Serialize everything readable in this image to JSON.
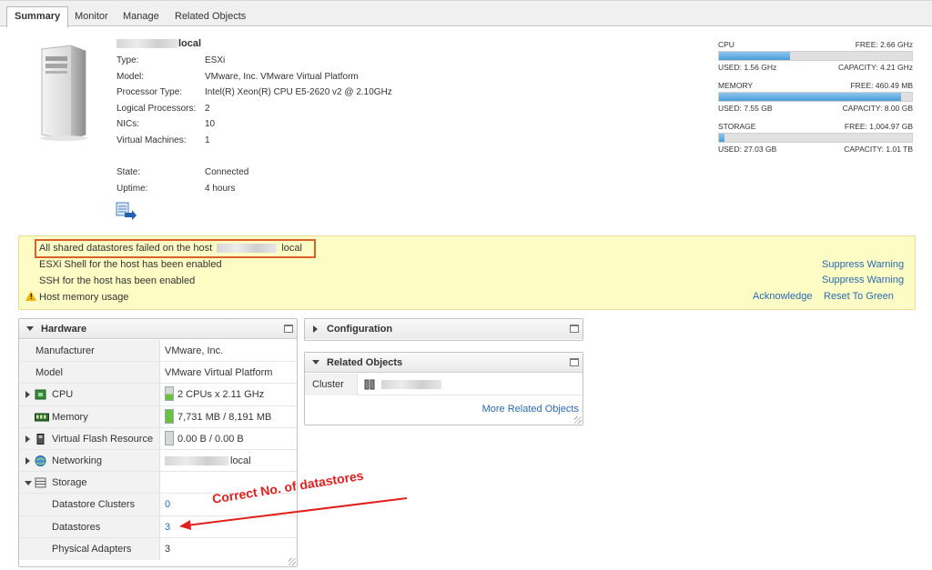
{
  "tabs": [
    {
      "label": "Summary",
      "active": true
    },
    {
      "label": "Monitor",
      "active": false
    },
    {
      "label": "Manage",
      "active": false
    },
    {
      "label": "Related Objects",
      "active": false
    }
  ],
  "host": {
    "name_suffix": "local",
    "fields": [
      {
        "key": "Type:",
        "value": "ESXi"
      },
      {
        "key": "Model:",
        "value": "VMware, Inc. VMware Virtual Platform"
      },
      {
        "key": "Processor Type:",
        "value": "Intel(R) Xeon(R) CPU E5-2620 v2 @ 2.10GHz"
      },
      {
        "key": "Logical Processors:",
        "value": "2"
      },
      {
        "key": "NICs:",
        "value": "10"
      },
      {
        "key": "Virtual Machines:",
        "value": "1"
      }
    ],
    "status": [
      {
        "key": "State:",
        "value": "Connected"
      },
      {
        "key": "Uptime:",
        "value": "4 hours"
      }
    ]
  },
  "resources": [
    {
      "name": "CPU",
      "free": "FREE: 2.66 GHz",
      "used": "USED: 1.56 GHz",
      "capacity": "CAPACITY: 4.21 GHz",
      "fraction": 0.37
    },
    {
      "name": "MEMORY",
      "free": "FREE: 460.49 MB",
      "used": "USED: 7.55 GB",
      "capacity": "CAPACITY: 8.00 GB",
      "fraction": 0.944
    },
    {
      "name": "STORAGE",
      "free": "FREE: 1,004.97 GB",
      "used": "USED: 27.03 GB",
      "capacity": "CAPACITY: 1.01 TB",
      "fraction": 0.027
    }
  ],
  "warnings": {
    "shared_ds_prefix": "All shared datastores failed on the host",
    "shared_ds_suffix": "local",
    "esxi_shell": "ESXi Shell for the host has been enabled",
    "ssh": "SSH for the host has been enabled",
    "memory": "Host memory usage",
    "suppress_label": "Suppress Warning",
    "acknowledge_label": "Acknowledge",
    "reset_label": "Reset To Green"
  },
  "hardware": {
    "title": "Hardware",
    "rows": [
      {
        "label": "Manufacturer",
        "value": "VMware, Inc."
      },
      {
        "label": "Model",
        "value": "VMware Virtual Platform"
      },
      {
        "label": "CPU",
        "value": "2 CPUs x 2.11 GHz"
      },
      {
        "label": "Memory",
        "value": "7,731 MB / 8,191 MB"
      },
      {
        "label": "Virtual Flash Resource",
        "value": "0.00 B / 0.00 B"
      },
      {
        "label": "Networking",
        "value": "local"
      },
      {
        "label": "Storage",
        "value": ""
      },
      {
        "label": "Datastore Clusters",
        "value": "0"
      },
      {
        "label": "Datastores",
        "value": "3"
      },
      {
        "label": "Physical Adapters",
        "value": "3"
      }
    ]
  },
  "configuration": {
    "title": "Configuration"
  },
  "related_objects": {
    "title": "Related Objects",
    "cluster_label": "Cluster",
    "more_link": "More Related Objects"
  },
  "annotation": {
    "text": "Correct No. of datastores",
    "color": "#e0201e"
  },
  "colors": {
    "link": "#2a6ab1",
    "warning_bg": "#fdfcc4",
    "highlight_border": "#d9622b",
    "meter_fill": "#4a9cd8"
  }
}
